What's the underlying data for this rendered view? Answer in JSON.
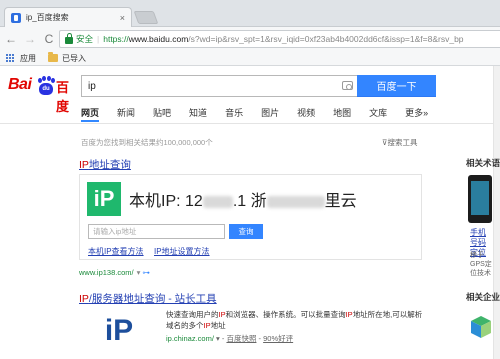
{
  "browser": {
    "tab_title": "ip_百度搜索",
    "tab_close": "×",
    "nav_back": "←",
    "nav_forward": "→",
    "nav_reload": "C",
    "secure_label": "安全",
    "separator": "|",
    "url_scheme": "https://",
    "url_host": "www.baidu.com",
    "url_rest": "/s?wd=ip&rsv_spt=1&rsv_iqid=0xf23ab4b4002dd6cf&issp=1&f=8&rsv_bp"
  },
  "bookmarks": {
    "apps_label": "应用",
    "folder_label": "已导入"
  },
  "header": {
    "logo_text_bai": "Bai",
    "logo_text_paw": "du",
    "logo_text_du": "百度",
    "query": "ip",
    "search_button": "百度一下"
  },
  "tabs": [
    "网页",
    "新闻",
    "贴吧",
    "知道",
    "音乐",
    "图片",
    "视频",
    "地图",
    "文库",
    "更多»"
  ],
  "results_info": {
    "count_text": "百度为您找到相关结果约100,000,000个",
    "tools_label": "搜索工具"
  },
  "result1": {
    "title_em": "IP",
    "title_rest": "地址查询",
    "logo_text": "iP",
    "ip_prefix": "本机IP: 12",
    "ip_mid": ".1  浙",
    "ip_end": "里云",
    "input_placeholder": "请输入ip地址",
    "query_button": "查询",
    "link_check": "本机IP查看方法",
    "link_set": "IP地址设置方法",
    "url": "www.ip138.com/",
    "arrow": "▾",
    "share": "⊶"
  },
  "result2": {
    "title_em1": "IP",
    "title_mid": "/服务器地址查询 - 站长工具",
    "thumb_text": "iP",
    "desc_a": "快速查询用户的",
    "desc_em1": "IP",
    "desc_b": "和浏览器、操作系统。可以批量查询",
    "desc_em2": "IP",
    "desc_c": "地址所在地,可以解析域名的多个",
    "desc_em3": "IP",
    "desc_d": "地址",
    "url_host": "ip.chinaz.com/",
    "url_sep": " ▾ - ",
    "snapshot": "百度快照",
    "dash": " - ",
    "rating": "90%好评"
  },
  "right": {
    "head1": "相关术语",
    "link": "手机号码定位",
    "sub": "移于GPS定位技术",
    "head2": "相关企业"
  }
}
